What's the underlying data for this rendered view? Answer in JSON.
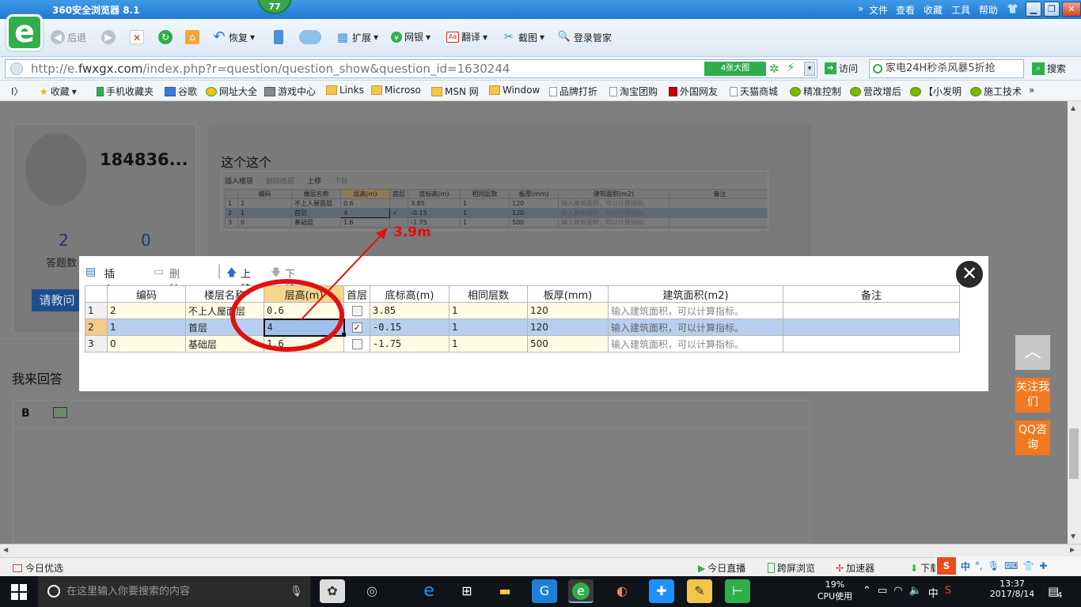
{
  "browser": {
    "title": "360安全浏览器 8.1",
    "badge": "77",
    "menu": [
      "文件",
      "查看",
      "收藏",
      "工具",
      "帮助"
    ],
    "toolbar": {
      "back": "后退",
      "restore": "恢复",
      "extend": "扩展",
      "netbank": "网银",
      "translate": "翻译",
      "screenshot": "截图",
      "login": "登录管家"
    },
    "url_prefix": "http://e.",
    "url_domain": "fwxgx.com",
    "url_path": "/index.php?r=question/question_show&question_id=1630244",
    "big_image": "4张大图",
    "visit": "访问",
    "search_value": "家电24H秒杀风暴5折抢",
    "search_button": "搜索",
    "favorites": [
      "收藏",
      "手机收藏夹",
      "谷歌",
      "网址大全",
      "游戏中心",
      "Links",
      "Microso",
      "MSN 网",
      "Window",
      "品牌打折",
      "淘宝团购",
      "外国网友",
      "天猫商城",
      "精准控制",
      "营改增后",
      "【小发明",
      "施工技术"
    ]
  },
  "page": {
    "username": "184836...",
    "stat1": "2",
    "stat2": "0",
    "stat_label": "答题数",
    "ask_button": "请教问",
    "question_text": "这个这个",
    "annotation": "3.9m",
    "reply_title": "我来回答",
    "editor_bold": "B",
    "follow_us": "关注我们",
    "qq": "QQ咨询"
  },
  "thumbnail": {
    "toolbar": [
      "插入楼层",
      "删除楼层",
      "上移",
      "下移"
    ],
    "headers": [
      "编码",
      "楼层名称",
      "层高(m)",
      "首层",
      "底标高(m)",
      "相同层数",
      "板厚(mm)",
      "建筑面积(m2)",
      "备注"
    ],
    "rows": [
      [
        "1",
        "2",
        "不上人屋面层",
        "0.6",
        "",
        "3.85",
        "1",
        "120",
        "输入建筑面积，可以计算指标。",
        ""
      ],
      [
        "2",
        "1",
        "首层",
        "4",
        "✓",
        "-0.15",
        "1",
        "120",
        "输入建筑面积，可以计算指标。",
        ""
      ],
      [
        "3",
        "0",
        "基础层",
        "1.6",
        "",
        "-1.75",
        "1",
        "500",
        "输入建筑面积，可以计算指标。",
        ""
      ]
    ]
  },
  "modal": {
    "toolbar": [
      "插入楼层",
      "删除楼层",
      "上移",
      "下移"
    ],
    "headers": [
      "编码",
      "楼层名称",
      "层高(m)",
      "首层",
      "底标高(m)",
      "相同层数",
      "板厚(mm)",
      "建筑面积(m2)",
      "备注"
    ],
    "rows": [
      {
        "idx": "1",
        "code": "2",
        "name": "不上人屋面层",
        "height": "0.6",
        "first": false,
        "base": "3.85",
        "same": "1",
        "slab": "120",
        "area": "输入建筑面积，可以计算指标。",
        "note": ""
      },
      {
        "idx": "2",
        "code": "1",
        "name": "首层",
        "height": "4",
        "first": true,
        "base": "-0.15",
        "same": "1",
        "slab": "120",
        "area": "输入建筑面积，可以计算指标。",
        "note": ""
      },
      {
        "idx": "3",
        "code": "0",
        "name": "基础层",
        "height": "1.6",
        "first": false,
        "base": "-1.75",
        "same": "1",
        "slab": "500",
        "area": "输入建筑面积，可以计算指标。",
        "note": ""
      }
    ],
    "close": "✕"
  },
  "statusbar": {
    "left": "今日优选",
    "live": "今日直播",
    "cross": "跨屏浏览",
    "accelerator": "加速器",
    "download": "下载"
  },
  "taskbar": {
    "search_placeholder": "在这里输入你要搜索的内容",
    "cpu_percent": "19%",
    "cpu_label": "CPU使用",
    "ime": "中",
    "time": "13:37",
    "date": "2017/8/14",
    "notifications": "4"
  },
  "colors": {
    "accent": "#f2781f",
    "annotation": "#e11010",
    "selected_row": "#b7cff0"
  }
}
